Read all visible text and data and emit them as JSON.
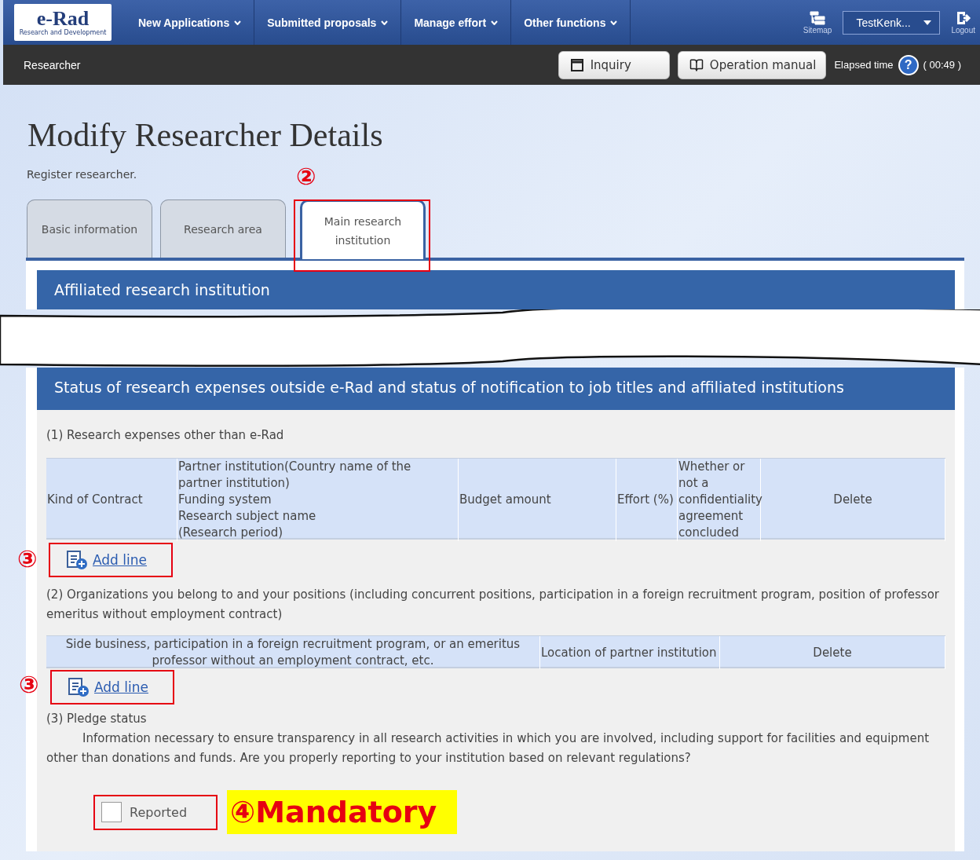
{
  "header": {
    "logo": {
      "title": "e-Rad",
      "subtitle": "Research and Development"
    },
    "menus": [
      {
        "label": "New Applications"
      },
      {
        "label": "Submitted proposals"
      },
      {
        "label": "Manage effort"
      },
      {
        "label": "Other functions"
      }
    ],
    "sitemap": "Sitemap",
    "user": "TestKenk...",
    "logout": "Logout"
  },
  "subbar": {
    "role": "Researcher",
    "buttons": [
      {
        "kind": "inquiry",
        "label": "Inquiry"
      },
      {
        "kind": "manual",
        "label": "Operation manual"
      }
    ],
    "elapsed_label": "Elapsed time",
    "help": "?",
    "elapsed": "( 00:49 )"
  },
  "page": {
    "title": "Modify Researcher Details",
    "subtitle": "Register researcher."
  },
  "tabs_annotation": "②",
  "tabs": [
    {
      "label": "Basic information",
      "selected": false
    },
    {
      "label": "Research area",
      "selected": false
    },
    {
      "label": "Main research institution",
      "selected": true
    }
  ],
  "section_1": {
    "title": "Affiliated research institution"
  },
  "section_2": {
    "title": "Status of research expenses outside e-Rad and status of notification to job titles and affiliated institutions",
    "part_1": {
      "heading": "(1) Research expenses other than e-Rad",
      "columns": [
        "Kind of Contract",
        "Partner institution(Country name of the partner institution)\nFunding system\nResearch subject name\n(Research period)",
        "Budget amount",
        "Effort (%)",
        "Whether or not a confidentiality agreement concluded",
        "Delete"
      ],
      "add_line": {
        "label": "Add line",
        "annotation": "③"
      }
    },
    "part_2": {
      "heading": "(2) Organizations you belong to and your positions (including concurrent positions, participation in a foreign recruitment program, position of professor emeritus without employment contract)",
      "columns": [
        "Side business, participation in a foreign recruitment program, or an emeritus professor without an employment contract, etc.",
        "Location of partner institution",
        "Delete"
      ],
      "add_line": {
        "label": "Add line",
        "annotation": "③"
      }
    },
    "part_3": {
      "heading": "(3) Pledge status",
      "text": "Information necessary to ensure transparency in all research activities in which you are involved, including support for facilities and equipment other than donations and funds. Are you properly reporting to your institution based on relevant regulations?",
      "checkbox": {
        "label": "Reported",
        "checked": false
      },
      "annotation": "④Mandatory"
    }
  }
}
